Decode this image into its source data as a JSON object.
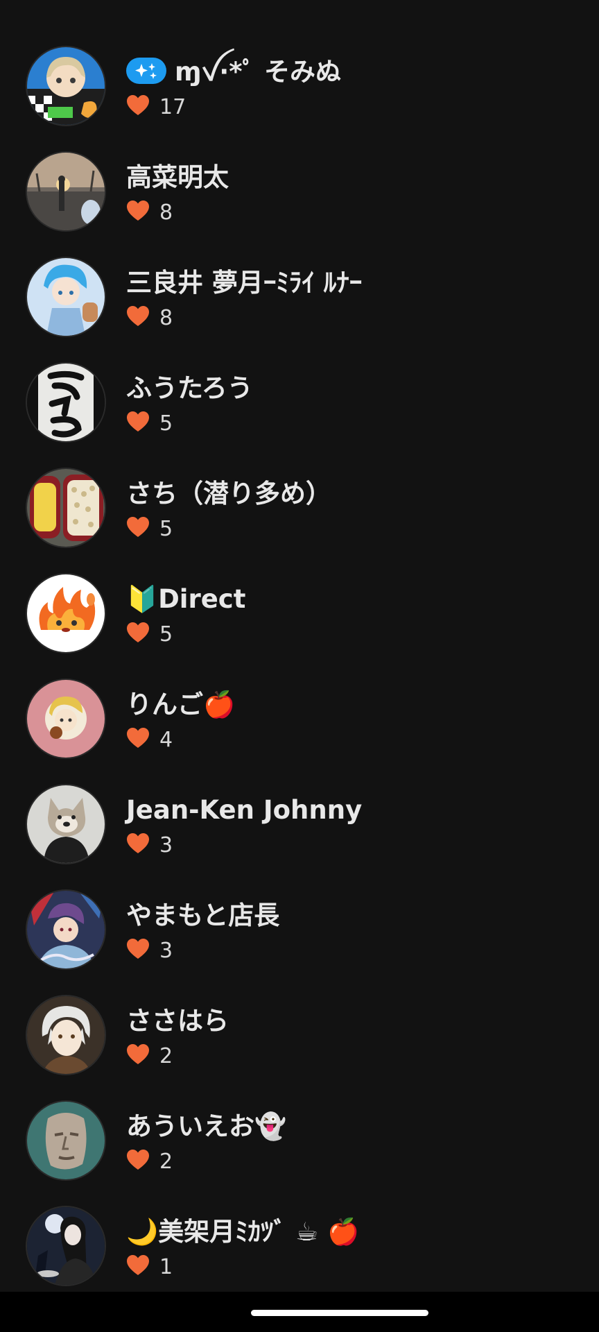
{
  "colors": {
    "background": "#121212",
    "name_text": "#e8e8e8",
    "count_text": "#d8d8d8",
    "heart": "#f26b3a",
    "badge": "#1d9bf0",
    "nav_bar": "#000000",
    "home_indicator": "#ffffff"
  },
  "icons": {
    "like": "heart-icon",
    "badge": "sparkles-badge-icon"
  },
  "users": [
    {
      "name": "ɱꪜ·*ﾟ そみぬ",
      "likes": "17",
      "has_badge": true,
      "avatar": "anime-girl-avatar"
    },
    {
      "name": "高菜明太",
      "likes": "8",
      "has_badge": false,
      "avatar": "sunset-park-avatar"
    },
    {
      "name": "三良井 夢月ｰﾐﾗｲ ﾙﾅｰ",
      "likes": "8",
      "has_badge": false,
      "avatar": "anime-boy-avatar"
    },
    {
      "name": "ふうたろう",
      "likes": "5",
      "has_badge": false,
      "avatar": "calligraphy-avatar"
    },
    {
      "name": "さち（潜り多め）",
      "likes": "5",
      "has_badge": false,
      "avatar": "bento-avatar"
    },
    {
      "name": "🔰Direct",
      "likes": "5",
      "has_badge": false,
      "avatar": "fire-demon-avatar"
    },
    {
      "name": "りんご🍎",
      "likes": "4",
      "has_badge": false,
      "avatar": "sticker-avatar"
    },
    {
      "name": "Jean-Ken Johnny",
      "likes": "3",
      "has_badge": false,
      "avatar": "wolf-mask-avatar"
    },
    {
      "name": "やまもと店長",
      "likes": "3",
      "has_badge": false,
      "avatar": "anime-art-avatar"
    },
    {
      "name": "ささはら",
      "likes": "2",
      "has_badge": false,
      "avatar": "white-hair-anime-avatar"
    },
    {
      "name": "あういえお👻",
      "likes": "2",
      "has_badge": false,
      "avatar": "stone-face-avatar"
    },
    {
      "name": "🌙美架月ﾐｶﾂﾞ ☕ 🍎",
      "likes": "1",
      "has_badge": false,
      "avatar": "night-anime-avatar"
    }
  ]
}
